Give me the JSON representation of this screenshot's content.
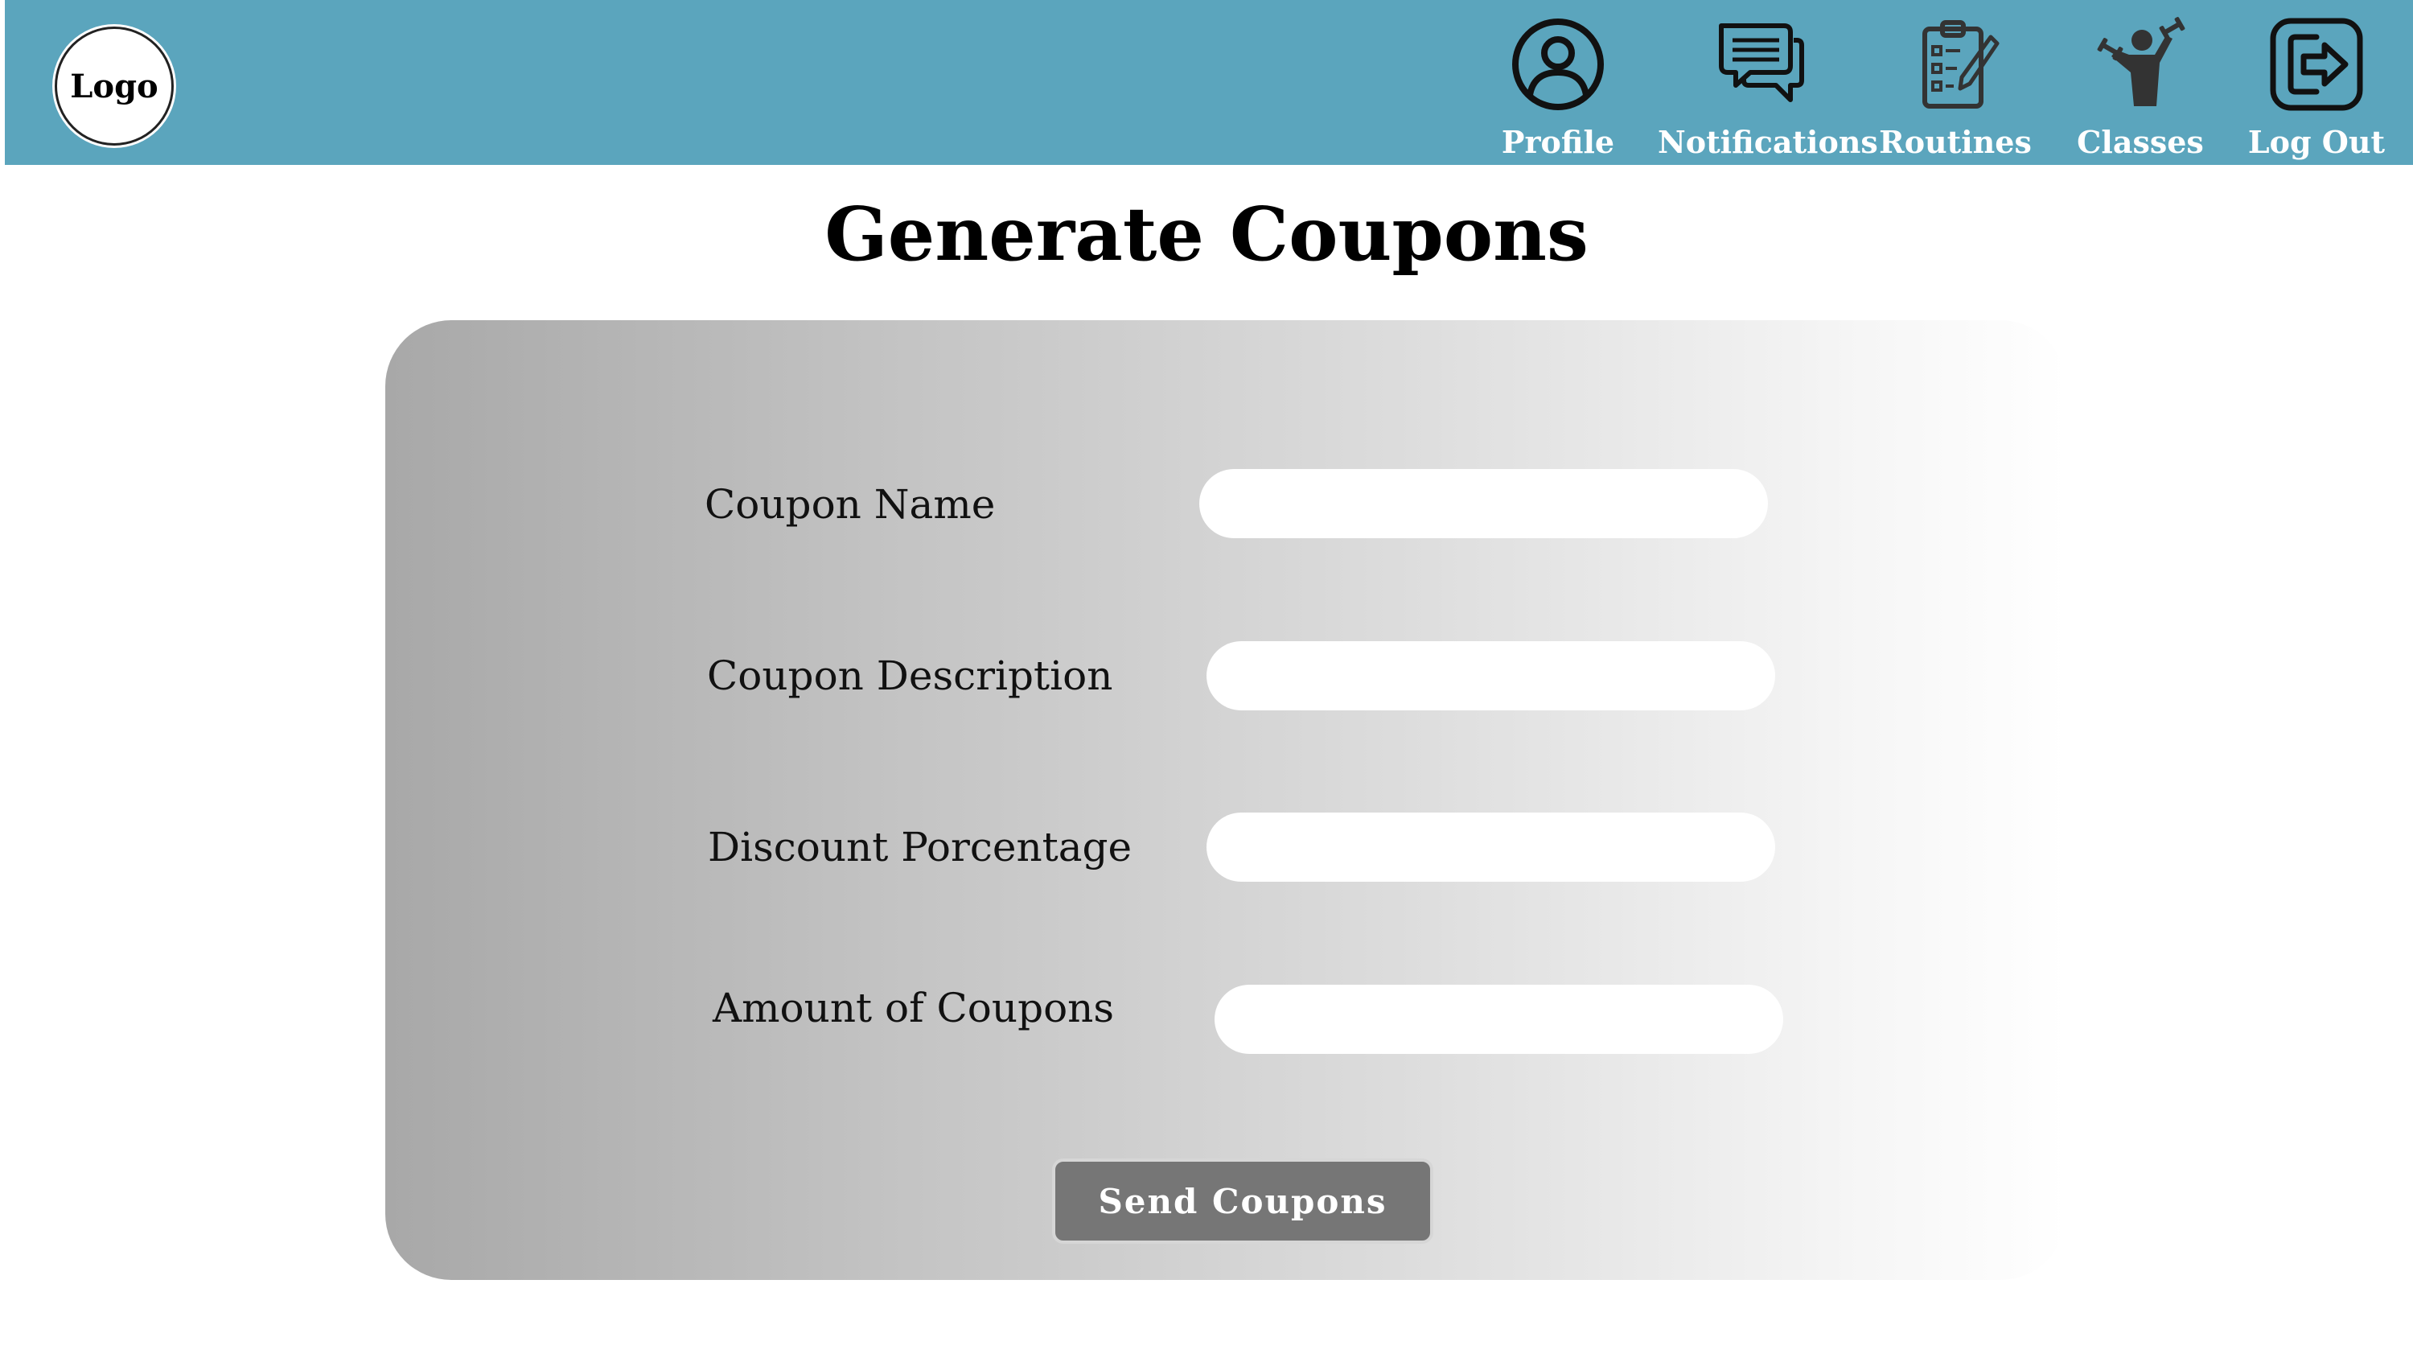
{
  "header": {
    "logo_text": "Logo",
    "background_color": "#5ba5bd",
    "nav": [
      {
        "label": "Profile",
        "icon": "profile-icon"
      },
      {
        "label": "Notifications",
        "icon": "chat-bubbles-icon"
      },
      {
        "label": "Routines",
        "icon": "clipboard-checklist-icon"
      },
      {
        "label": "Classes",
        "icon": "weightlifter-icon"
      },
      {
        "label": "Log Out",
        "icon": "logout-icon"
      }
    ]
  },
  "page": {
    "title": "Generate Coupons"
  },
  "form": {
    "fields": [
      {
        "label": "Coupon Name",
        "value": ""
      },
      {
        "label": "Coupon Description",
        "value": ""
      },
      {
        "label": "Discount Porcentage",
        "value": ""
      },
      {
        "label": "Amount of Coupons",
        "value": ""
      }
    ],
    "submit_label": "Send Coupons",
    "button_color": "#767676"
  }
}
